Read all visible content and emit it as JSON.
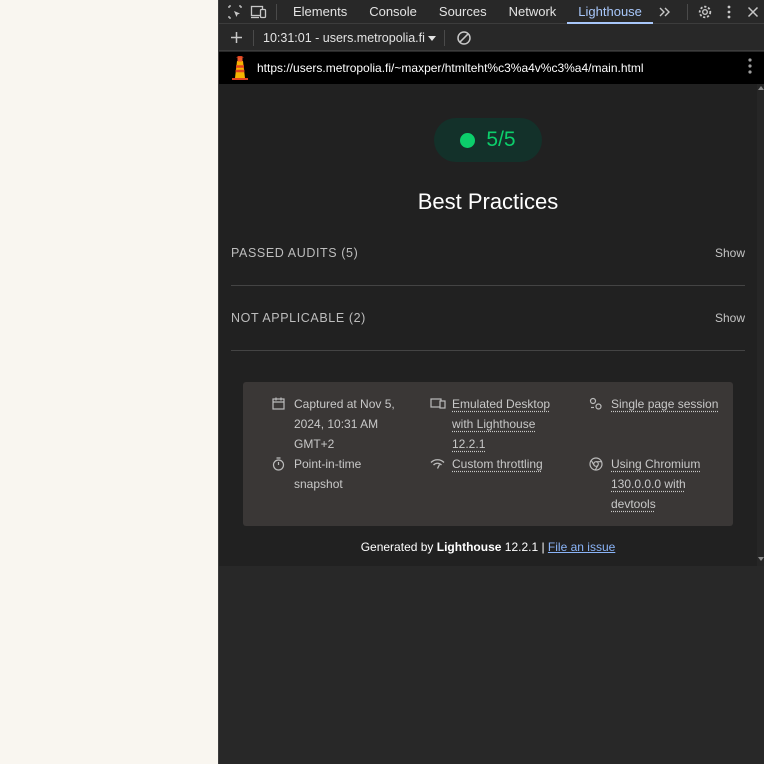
{
  "devtools": {
    "tabs": [
      {
        "label": "Elements"
      },
      {
        "label": "Console"
      },
      {
        "label": "Sources"
      },
      {
        "label": "Network"
      },
      {
        "label": "Lighthouse"
      }
    ],
    "active_tab": "Lighthouse",
    "accent_color": "#a8c7fa"
  },
  "lighthouse_toolbar": {
    "report_select": "10:31:01 - users.metropolia.fi"
  },
  "url_bar": {
    "url": "https://users.metropolia.fi/~maxper/htmlteht%c3%a4v%c3%a4/main.html"
  },
  "report": {
    "score": "5/5",
    "score_color": "#0cce6b",
    "category_title": "Best Practices",
    "groups": [
      {
        "title": "PASSED AUDITS (5)",
        "action": "Show"
      },
      {
        "title": "NOT APPLICABLE (2)",
        "action": "Show"
      }
    ],
    "meta": {
      "captured": "Captured at Nov 5, 2024, 10:31 AM GMT+2",
      "device": "Emulated Desktop with Lighthouse 12.2.1",
      "session": "Single page session",
      "snapshot": "Point-in-time snapshot",
      "throttling": "Custom throttling",
      "browser": "Using Chromium 130.0.0.0 with devtools"
    },
    "footer": {
      "prefix": "Generated by ",
      "brand": "Lighthouse",
      "version": " 12.2.1 | ",
      "link": "File an issue"
    }
  }
}
